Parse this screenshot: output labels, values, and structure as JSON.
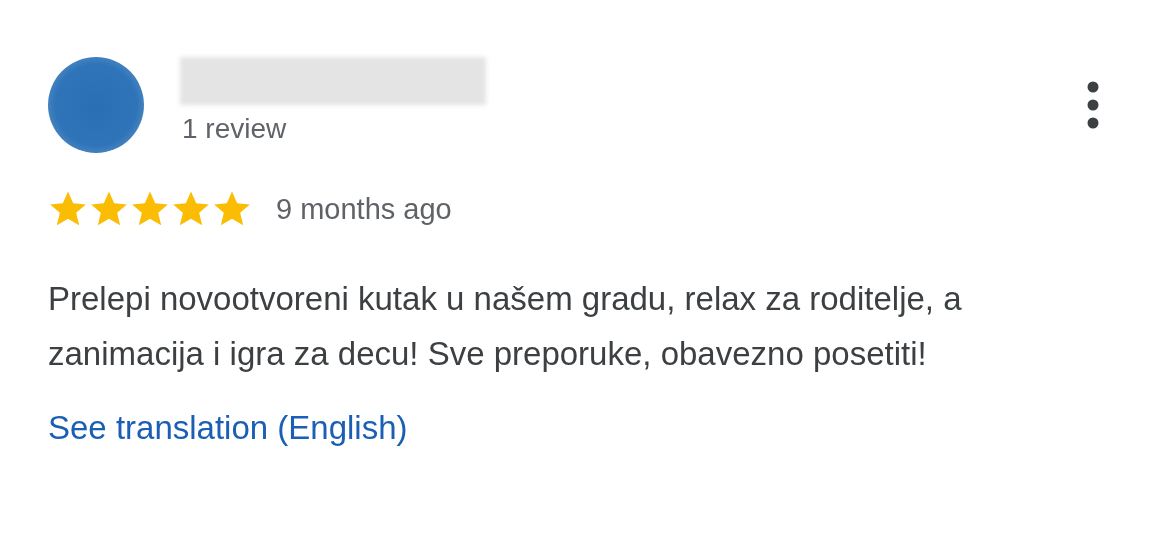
{
  "review": {
    "review_count": "1 review",
    "stars": 5,
    "time": "9 months ago",
    "text": "Prelepi novootvoreni kutak u našem gradu, relax za roditelje, a zanimacija i igra za decu! Sve preporuke, obavezno posetiti!",
    "translation_link": "See translation (English)"
  }
}
